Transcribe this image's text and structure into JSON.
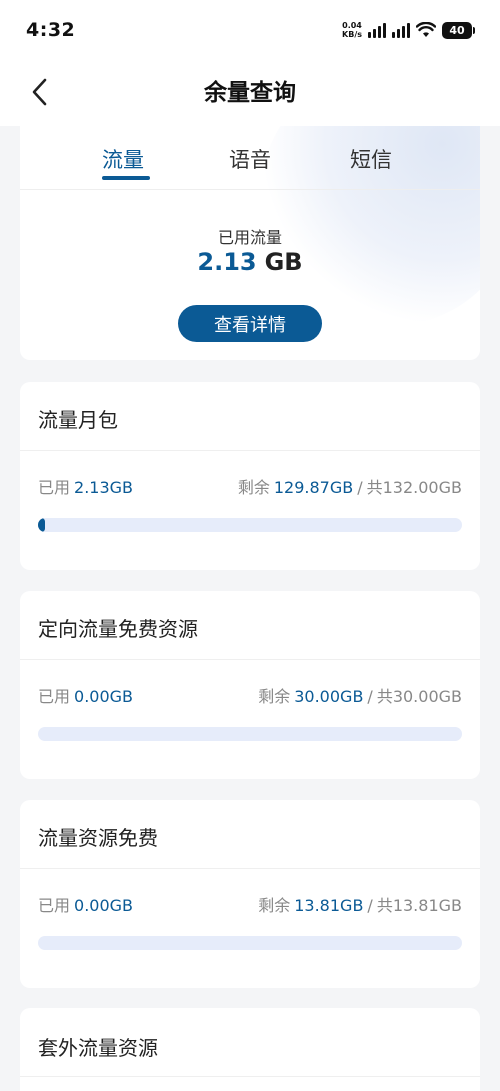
{
  "status_bar": {
    "time": "4:32",
    "net_speed_value": "0.04",
    "net_speed_unit": "KB/s",
    "battery": "40",
    "icons": [
      "signal-icon",
      "signal-icon",
      "wifi-icon",
      "battery-icon"
    ]
  },
  "header": {
    "title": "余量查询",
    "back_icon": "chevron-left-icon"
  },
  "tabs": [
    {
      "label": "流量",
      "active": true
    },
    {
      "label": "语音",
      "active": false
    },
    {
      "label": "短信",
      "active": false
    }
  ],
  "summary": {
    "used_label": "已用流量",
    "used_value": "2.13",
    "used_unit": "GB",
    "detail_button": "查看详情"
  },
  "resources": [
    {
      "title": "流量月包",
      "used_label": "已用",
      "used_value": "2.13GB",
      "remain_label": "剩余",
      "remain_value": "129.87GB",
      "separator": "/",
      "total": "共132.00GB",
      "progress_fraction": 0.016
    },
    {
      "title": "定向流量免费资源",
      "used_label": "已用",
      "used_value": "0.00GB",
      "remain_label": "剩余",
      "remain_value": "30.00GB",
      "separator": "/",
      "total": "共30.00GB",
      "progress_fraction": 0
    },
    {
      "title": "流量资源免费",
      "used_label": "已用",
      "used_value": "0.00GB",
      "remain_label": "剩余",
      "remain_value": "13.81GB",
      "separator": "/",
      "total": "共13.81GB",
      "progress_fraction": 0
    }
  ],
  "extra_section": {
    "title": "套外流量资源"
  },
  "colors": {
    "accent": "#0b5a95",
    "bar_track": "#e6ecfa",
    "background": "#f4f5f7"
  }
}
